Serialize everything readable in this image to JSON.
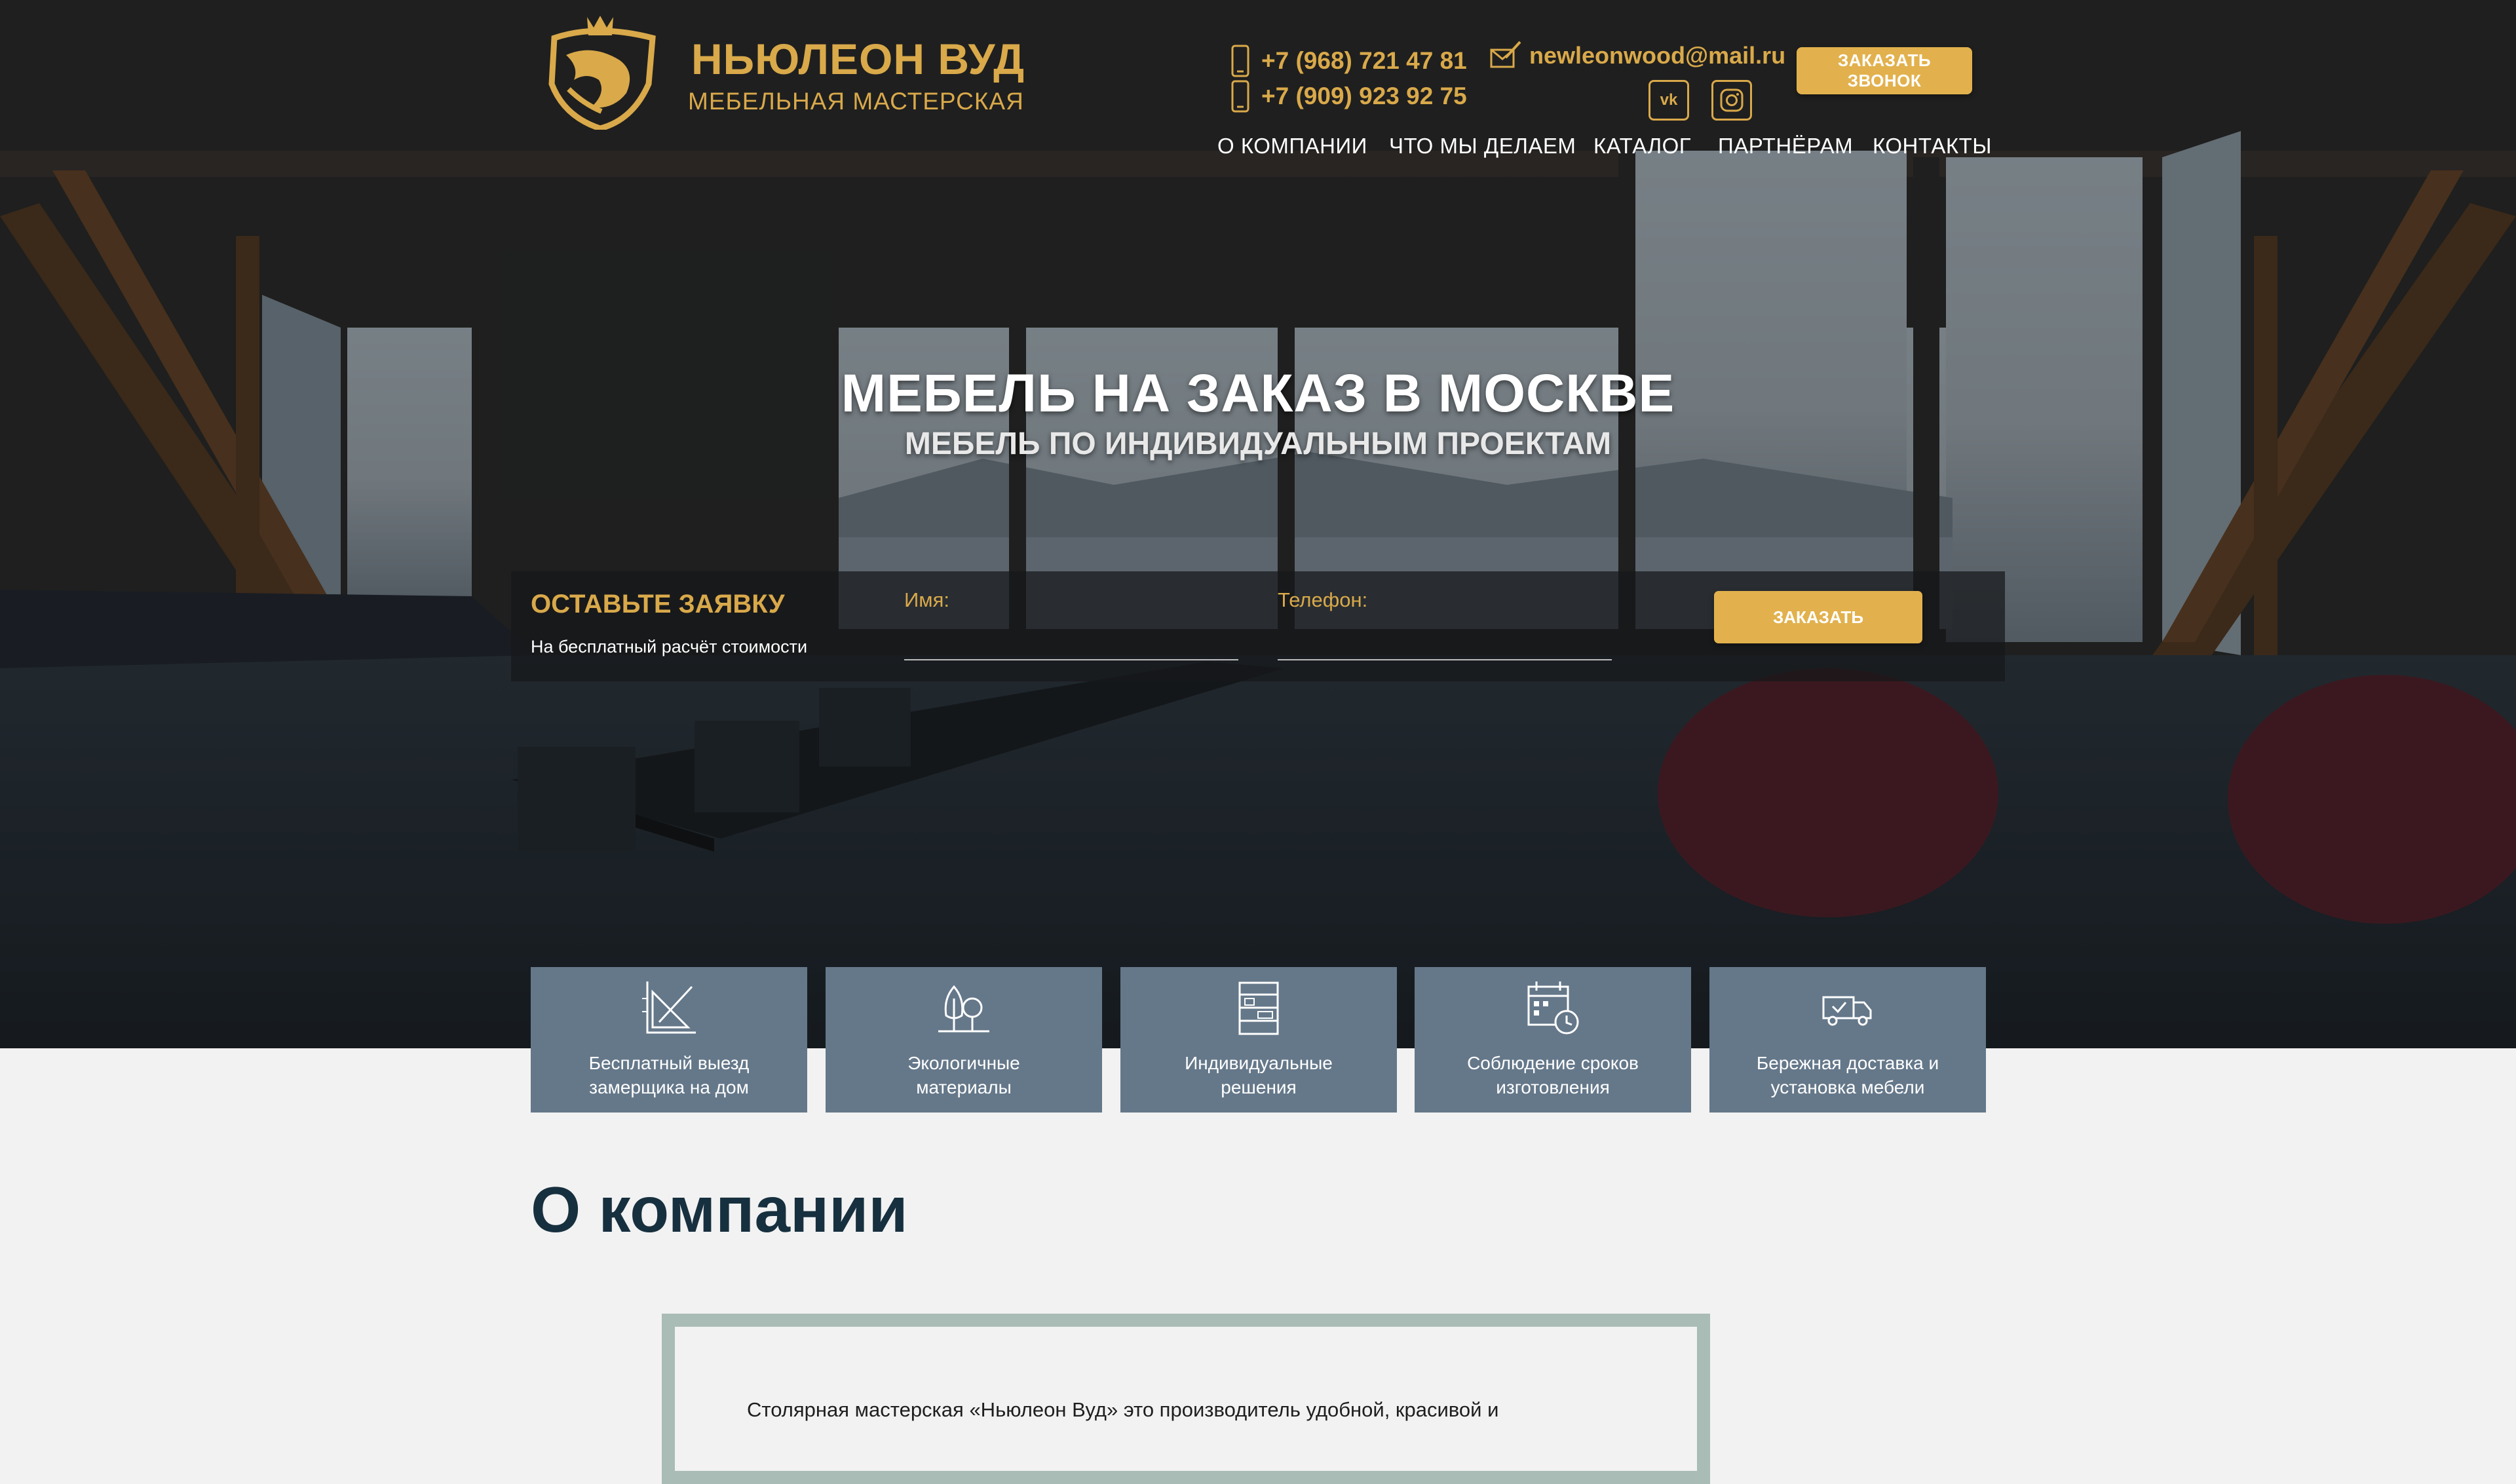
{
  "header": {
    "brand_name": "НЬЮЛЕОН ВУД",
    "brand_sub": "МЕБЕЛЬНАЯ МАСТЕРСКАЯ",
    "phones": [
      "+7 (968) 721 47 81",
      "+7 (909) 923 92 75"
    ],
    "email": "newleonwood@mail.ru",
    "callback_label": "ЗАКАЗАТЬ ЗВОНОК",
    "social": [
      "vk-icon",
      "instagram-icon"
    ]
  },
  "nav": {
    "items": [
      "О КОМПАНИИ",
      "ЧТО МЫ ДЕЛАЕМ",
      "КАТАЛОГ",
      "ПАРТНЁРАМ",
      "КОНТАКТЫ"
    ]
  },
  "hero": {
    "title": "МЕБЕЛЬ НА ЗАКАЗ В МОСКВЕ",
    "subtitle": "МЕБЕЛЬ ПО ИНДИВИДУАЛЬНЫМ ПРОЕКТАМ"
  },
  "form": {
    "title": "ОСТАВЬТЕ ЗАЯВКУ",
    "subtitle": "На бесплатный расчёт стоимости",
    "name_label": "Имя:",
    "phone_label": "Телефон:",
    "submit_label": "ЗАКАЗАТЬ"
  },
  "features": [
    {
      "icon": "drafting-tools-icon",
      "line1": "Бесплатный выезд",
      "line2": "замерщика на дом"
    },
    {
      "icon": "trees-icon",
      "line1": "Экологичные",
      "line2": "материалы"
    },
    {
      "icon": "shelving-icon",
      "line1": "Индивидуальные",
      "line2": "решения"
    },
    {
      "icon": "calendar-clock-icon",
      "line1": "Соблюдение сроков",
      "line2": "изготовления"
    },
    {
      "icon": "delivery-truck-icon",
      "line1": "Бережная доставка и",
      "line2": "установка мебели"
    }
  ],
  "about": {
    "title": "О компании",
    "text": "Столярная мастерская «Ньюлеон Вуд» это производитель удобной, красивой и"
  },
  "colors": {
    "accent": "#e2b14d",
    "gold_text": "#d9a94a",
    "card_bg": "#65788a",
    "heading": "#17303f",
    "frame": "#a9bcb6"
  }
}
